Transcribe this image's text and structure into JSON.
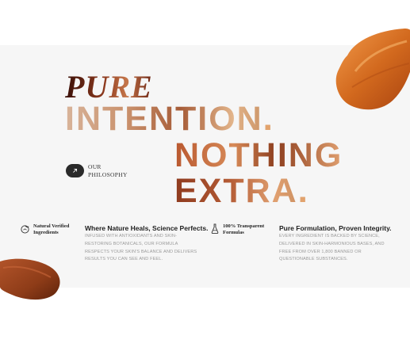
{
  "hero": {
    "line1": "PURE",
    "line2": "INTENTION",
    "line3": "NOTHING",
    "line4": "EXTRA",
    "period": "."
  },
  "philosophy": {
    "label_line1": "OUR",
    "label_line2": "PHILOSOPHY",
    "arrow_icon": "arrow-up-right-icon"
  },
  "features": [
    {
      "icon": "leaf-drop-icon",
      "tag_line1": "Natural Verified",
      "tag_line2": "Ingredients",
      "title": "Where Nature Heals, Science Perfects.",
      "body": "INFUSED WITH ANTIOXIDANTS AND SKIN-RESTORING BOTANICALS, OUR FORMULA RESPECTS YOUR SKIN'S BALANCE AND DELIVERS RESULTS YOU CAN SEE AND FEEL."
    },
    {
      "icon": "flask-icon",
      "tag_line1": "100% Transparent",
      "tag_line2": "Formulas",
      "title": "Pure Formulation, Proven Integrity.",
      "body": "EVERY INGREDIENT IS BACKED BY SCIENCE, DELIVERED IN SKIN-HARMONIOUS BASES, AND FREE FROM OVER 1,800 BANNED OR QUESTIONABLE SUBSTANCES."
    }
  ],
  "colors": {
    "band": "#f6f6f6",
    "accent": "#e2a36d",
    "swatch": "#c85a1e",
    "dark": "#2a2a2a"
  }
}
